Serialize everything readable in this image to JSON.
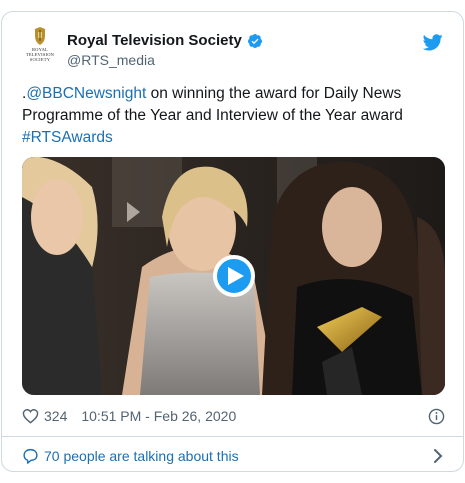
{
  "account": {
    "display_name": "Royal Television Society",
    "handle": "@RTS_media",
    "avatar_text": "ROYAL TELEVISION SOCIETY",
    "verified": true
  },
  "tweet": {
    "prefix": ".",
    "mention": "@BBCNewsnight",
    "body": " on winning the award for Daily News Programme of the Year and Interview of the Year award ",
    "hashtag": "#RTSAwards"
  },
  "media": {
    "type": "video",
    "play_icon": "play-icon"
  },
  "meta": {
    "likes": "324",
    "timestamp": "10:51 PM - Feb 26, 2020"
  },
  "footer": {
    "conversation_text": "70 people are talking about this"
  },
  "colors": {
    "link": "#1b6fb3",
    "brand": "#1d9bf0",
    "muted": "#536471",
    "border": "#cfd9de"
  }
}
